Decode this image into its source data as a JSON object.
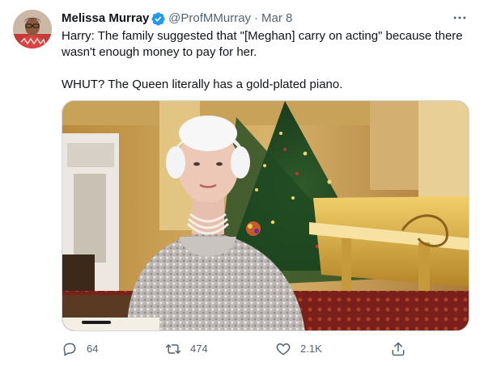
{
  "tweet": {
    "author": {
      "name": "Melissa Murray",
      "handle": "@ProfMMurray",
      "separator": "·",
      "date": "Mar 8",
      "verified": true
    },
    "text": {
      "line1": "Harry: The family suggested that \"[Meghan] carry on acting\" because there wasn't enough money to pay for her.",
      "line2": "WHUT? The Queen literally has a gold-plated piano."
    },
    "actions": {
      "reply_count": "64",
      "retweet_count": "474",
      "like_count": "2.1K"
    },
    "icons": {
      "verified": "verified-badge-icon",
      "more": "more-dots-icon",
      "reply": "reply-icon",
      "retweet": "retweet-icon",
      "like": "heart-icon",
      "share": "share-icon"
    },
    "colors": {
      "accent": "#1d9bf0",
      "muted": "#536471",
      "text": "#0f1419",
      "border": "#cfd9de"
    }
  }
}
